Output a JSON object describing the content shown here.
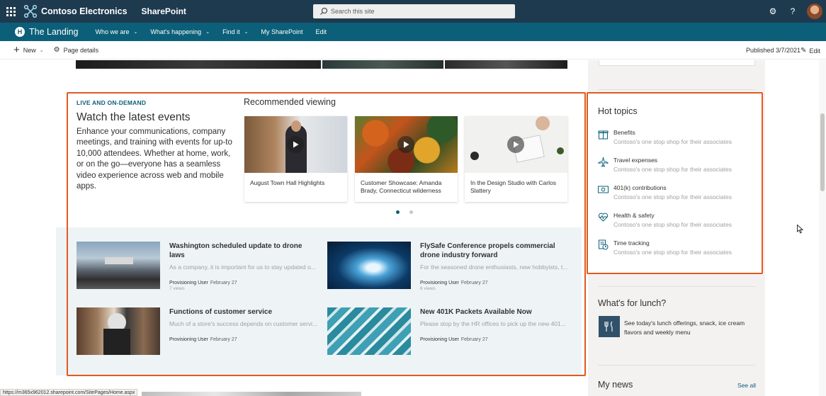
{
  "suitebar": {
    "brand": "Contoso Electronics",
    "app": "SharePoint",
    "search_placeholder": "Search this site",
    "colors": {
      "background": "#1e3a4f"
    }
  },
  "hubnav": {
    "title": "The Landing",
    "logo_letter": "H",
    "items": [
      {
        "label": "Who we are",
        "has_menu": true
      },
      {
        "label": "What's happening",
        "has_menu": true
      },
      {
        "label": "Find it",
        "has_menu": true
      },
      {
        "label": "My SharePoint",
        "has_menu": false
      },
      {
        "label": "Edit",
        "has_menu": false
      }
    ],
    "colors": {
      "background": "#0c5f78"
    }
  },
  "commandbar": {
    "new_label": "New",
    "page_details_label": "Page details",
    "published": "Published 3/7/2021",
    "edit_label": "Edit"
  },
  "events": {
    "eyebrow": "LIVE AND ON-DEMAND",
    "title": "Watch the latest events",
    "body": "Enhance your communications, company meetings, and training with events for up-to 10,000 attendees. Whether at home, work, or on the go—everyone has a seamless video experience across web and mobile apps."
  },
  "recommended": {
    "title": "Recommended viewing",
    "videos": [
      {
        "label": "August Town Hall Highlights"
      },
      {
        "label": "Customer Showcase: Amanda Brady, Connecticut wilderness"
      },
      {
        "label": "In the Design Studio with Carlos Slattery"
      }
    ],
    "page_count": 2,
    "active_page": 1
  },
  "news": [
    {
      "title": "Washington scheduled update to drone laws",
      "desc": "As a company, it is important for us to stay updated o...",
      "author": "Provisioning User",
      "date": "February 27",
      "views": "7 views"
    },
    {
      "title": "FlySafe Conference propels commercial drone industry forward",
      "desc": "For the seasoned drone enthusiasts, new hobbyists, t...",
      "author": "Provisioning User",
      "date": "February 27",
      "views": "6 views"
    },
    {
      "title": "Functions of customer service",
      "desc": "Much of a store's success depends on customer servi...",
      "author": "Provisioning User",
      "date": "February 27",
      "views": ""
    },
    {
      "title": "New 401K Packets Available Now",
      "desc": "Please stop by the HR offices to pick up the new 401...",
      "author": "Provisioning User",
      "date": "February 27",
      "views": ""
    }
  ],
  "hot_topics": {
    "title": "Hot topics",
    "items": [
      {
        "name": "Benefits",
        "desc": "Contoso's one stop shop for their associates",
        "icon": "gift-icon"
      },
      {
        "name": "Travel expenses",
        "desc": "Contoso's one stop shop for their associates",
        "icon": "airplane-icon"
      },
      {
        "name": "401(k) contributions",
        "desc": "Contoso's one stop shop for their associates",
        "icon": "money-icon"
      },
      {
        "name": "Health & safety",
        "desc": "Contoso's one stop shop for their associates",
        "icon": "heart-pulse-icon"
      },
      {
        "name": "Time tracking",
        "desc": "Contoso's one stop shop for their associates",
        "icon": "timesheet-icon"
      }
    ]
  },
  "lunch": {
    "title": "What's for lunch?",
    "text": "See today's lunch offerings, snack, ice cream flavors and weekly menu"
  },
  "mynews": {
    "title": "My news",
    "see_all": "See all"
  },
  "status_url": "https://m365x962012.sharepoint.com/SitePages/Home.aspx",
  "colors": {
    "accent": "#0c5f78",
    "highlight": "#e05a1f"
  }
}
